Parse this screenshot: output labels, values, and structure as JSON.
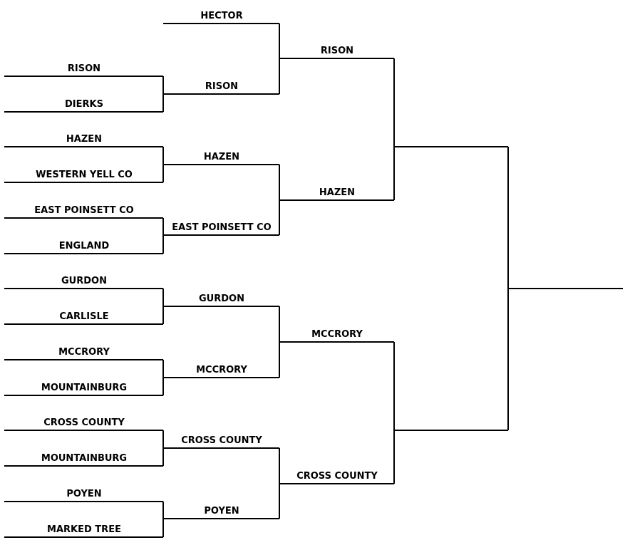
{
  "bracket": {
    "round1": [
      "RISON",
      "DIERKS",
      "HAZEN",
      "WESTERN YELL CO",
      "EAST POINSETT CO",
      "ENGLAND",
      "GURDON",
      "CARLISLE",
      "MCCRORY",
      "MOUNTAINBURG",
      "CROSS COUNTY",
      "MOUNTAINBURG",
      "POYEN",
      "MARKED TREE"
    ],
    "round2": [
      "HECTOR",
      "RISON",
      "HAZEN",
      "EAST POINSETT CO",
      "GURDON",
      "MCCRORY",
      "CROSS COUNTY",
      "POYEN"
    ],
    "round3": [
      "RISON",
      "HAZEN",
      "MCCRORY",
      "CROSS COUNTY"
    ],
    "round4": [
      "",
      ""
    ],
    "final": [
      ""
    ]
  }
}
